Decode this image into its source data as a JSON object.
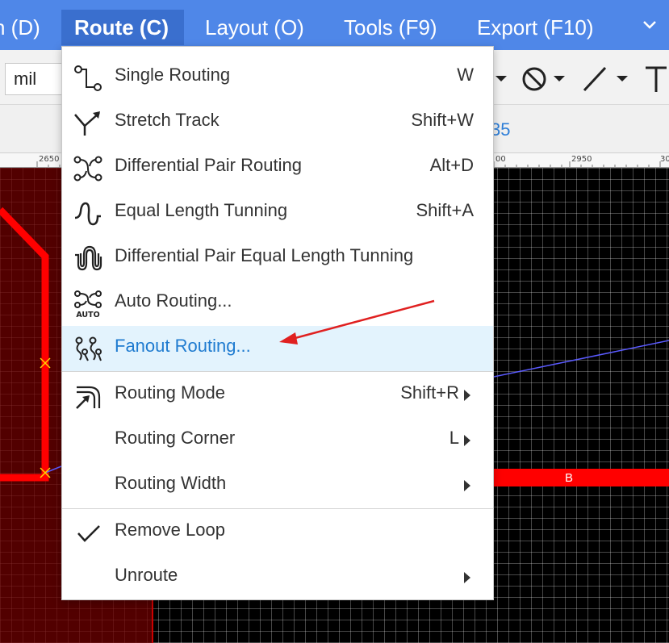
{
  "menubar": {
    "items": [
      {
        "label": "n (D)"
      },
      {
        "label": "Route (C)"
      },
      {
        "label": "Layout (O)"
      },
      {
        "label": "Tools (F9)"
      },
      {
        "label": "Export (F10)"
      }
    ],
    "chevron_icon": "chevron-down-icon"
  },
  "toolbar": {
    "unit_value": "mil",
    "icons": [
      "no-entry-icon",
      "line-tool-icon",
      "text-tool-icon"
    ]
  },
  "subbar": {
    "value_fragment": "35"
  },
  "ruler": {
    "labels": [
      "2650",
      "00",
      "2950",
      "30"
    ]
  },
  "canvas": {
    "pad_label": "B",
    "colors": {
      "track": "#ff0000",
      "board_fill": "#6e0000",
      "ratsnest": "#5a5aff",
      "marker": "#ffd400"
    }
  },
  "route_menu": {
    "items": [
      {
        "label": "Single Routing",
        "shortcut": "W",
        "icon": "single-routing-icon"
      },
      {
        "label": "Stretch Track",
        "shortcut": "Shift+W",
        "icon": "stretch-track-icon"
      },
      {
        "label": "Differential Pair Routing",
        "shortcut": "Alt+D",
        "icon": "differential-pair-icon"
      },
      {
        "label": "Equal Length Tunning",
        "shortcut": "Shift+A",
        "icon": "equal-length-icon"
      },
      {
        "label": "Differential Pair Equal Length Tunning",
        "shortcut": "",
        "icon": "diff-pair-equal-length-icon"
      },
      {
        "label": "Auto Routing...",
        "shortcut": "",
        "icon": "auto-routing-icon",
        "icon_text": "AUTO"
      },
      {
        "label": "Fanout Routing...",
        "shortcut": "",
        "icon": "fanout-routing-icon"
      },
      {
        "label": "Routing Mode",
        "shortcut": "Shift+R",
        "icon": "routing-mode-icon"
      },
      {
        "label": "Routing Corner",
        "shortcut": "L",
        "icon": ""
      },
      {
        "label": "Routing Width",
        "shortcut": "",
        "icon": ""
      },
      {
        "label": "Remove Loop",
        "shortcut": "",
        "icon": "checkmark-icon"
      },
      {
        "label": "Unroute",
        "shortcut": "",
        "icon": ""
      }
    ]
  },
  "annotation": {
    "color": "#e02020"
  }
}
